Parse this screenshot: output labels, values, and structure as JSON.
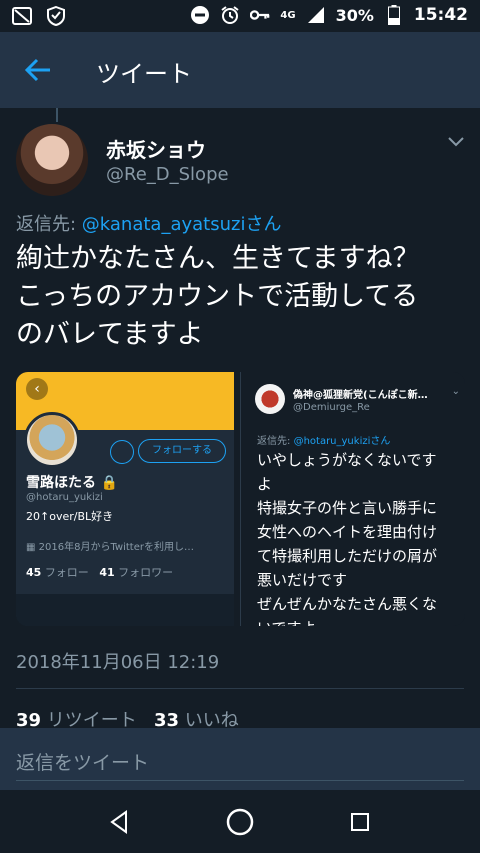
{
  "status_bar": {
    "network": "4G",
    "battery": "30%",
    "time": "15:42"
  },
  "app_bar": {
    "title": "ツイート"
  },
  "tweet": {
    "author_name": "赤坂ショウ",
    "author_handle": "@Re_D_Slope",
    "reply_prefix": "返信先: ",
    "reply_mention": "@kanata_ayatsuziさん",
    "text": "絢辻かなたさん、生きてますね？\nこっちのアカウントで活動してる\nのバレてますよ",
    "timestamp": "2018年11月06日 12:19",
    "retweet_count": "39",
    "retweet_label": "リツイート",
    "like_count": "33",
    "like_label": "いいね"
  },
  "media": {
    "profile_shot": {
      "follow_label": "フォローする",
      "name": "雪路ほたる",
      "handle": "@hotaru_yukizi",
      "bio": "20↑over/BL好き",
      "joined": "2016年8月からTwitterを利用し…",
      "following_count": "45",
      "following_label": "フォロー",
      "followers_count": "41",
      "followers_label": "フォロワー"
    },
    "reply_shot": {
      "name": "偽神@狐狸新党(こんぽこ新…",
      "handle": "@Demiurge_Re",
      "reply_prefix": "返信先: ",
      "reply_mention": "@hotaru_yukiziさん",
      "text": "いやしょうがなくないです\nよ\n特撮女子の件と言い勝手に\n女性へのヘイトを理由付け\nて特撮利用しただけの屑が\n悪いだけです\nぜんぜんかなたさん悪くな\nいですよ"
    }
  },
  "reply_bar": {
    "placeholder": "返信をツイート"
  },
  "colors": {
    "background": "#141d26",
    "header": "#243447",
    "accent": "#1da1f2",
    "muted": "#8899a6",
    "banner": "#f7b924"
  },
  "icons": [
    "wifi-off-icon",
    "vpn-shield-icon",
    "dnd-icon",
    "alarm-icon",
    "key-icon",
    "signal-icon",
    "battery-icon",
    "back-arrow-icon",
    "chevron-down-icon",
    "lock-icon",
    "calendar-icon",
    "nav-back-icon",
    "nav-home-icon",
    "nav-recents-icon"
  ]
}
